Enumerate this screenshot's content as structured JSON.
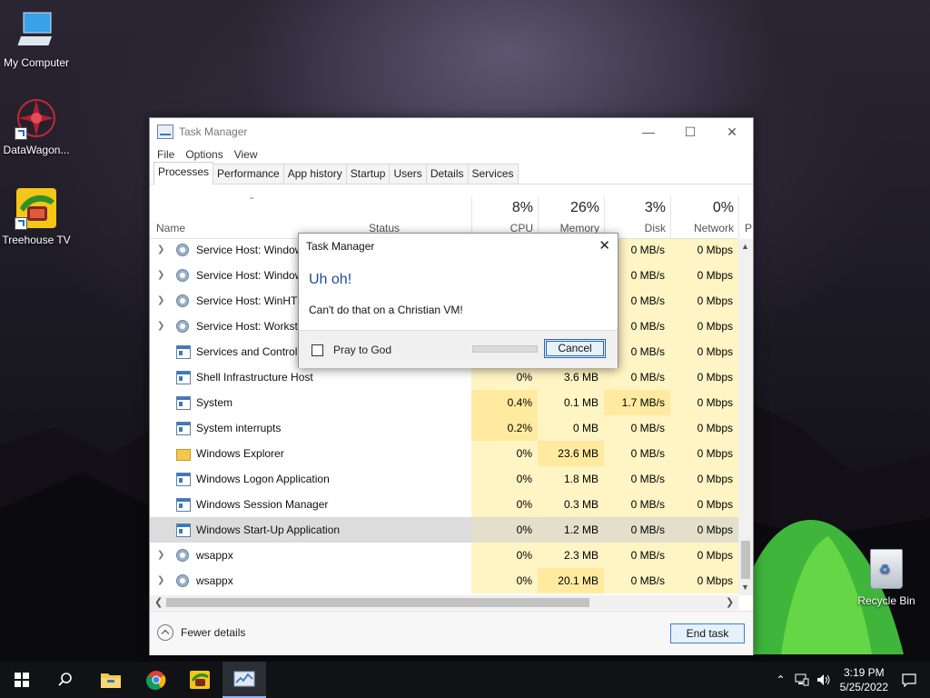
{
  "desktop": {
    "icons": [
      {
        "label": "My Computer",
        "icon": "computer-icon"
      },
      {
        "label": "DataWagon...",
        "icon": "datawagon-icon"
      },
      {
        "label": "Treehouse TV",
        "icon": "treehouse-tv-icon"
      }
    ],
    "recycle_bin": "Recycle Bin"
  },
  "task_manager": {
    "title": "Task Manager",
    "menu": [
      "File",
      "Options",
      "View"
    ],
    "tabs": [
      "Processes",
      "Performance",
      "App history",
      "Startup",
      "Users",
      "Details",
      "Services"
    ],
    "active_tab": "Processes",
    "columns": {
      "name": "Name",
      "status": "Status",
      "cpu": {
        "label": "CPU",
        "percent": "8%"
      },
      "memory": {
        "label": "Memory",
        "percent": "26%"
      },
      "disk": {
        "label": "Disk",
        "percent": "3%"
      },
      "network": {
        "label": "Network",
        "percent": "0%"
      },
      "power": "P"
    },
    "rows": [
      {
        "name": "Service Host: Window",
        "icon": "gear",
        "expand": true,
        "cpu": "",
        "memory": "",
        "disk": "0 MB/s",
        "network": "0 Mbps"
      },
      {
        "name": "Service Host: Window",
        "icon": "gear",
        "expand": true,
        "cpu": "",
        "memory": "",
        "disk": "0 MB/s",
        "network": "0 Mbps"
      },
      {
        "name": "Service Host: WinHTT",
        "icon": "gear",
        "expand": true,
        "cpu": "",
        "memory": "",
        "disk": "0 MB/s",
        "network": "0 Mbps"
      },
      {
        "name": "Service Host: Worksta",
        "icon": "gear",
        "expand": true,
        "cpu": "",
        "memory": "",
        "disk": "0 MB/s",
        "network": "0 Mbps"
      },
      {
        "name": "Services and Controlle",
        "icon": "win",
        "expand": false,
        "cpu": "",
        "memory": "",
        "disk": "0 MB/s",
        "network": "0 Mbps"
      },
      {
        "name": "Shell Infrastructure Host",
        "icon": "win",
        "expand": false,
        "cpu": "0%",
        "memory": "3.6 MB",
        "disk": "0 MB/s",
        "network": "0 Mbps"
      },
      {
        "name": "System",
        "icon": "win",
        "expand": false,
        "cpu": "0.4%",
        "memory": "0.1 MB",
        "disk": "1.7 MB/s",
        "network": "0 Mbps"
      },
      {
        "name": "System interrupts",
        "icon": "win",
        "expand": false,
        "cpu": "0.2%",
        "memory": "0 MB",
        "disk": "0 MB/s",
        "network": "0 Mbps"
      },
      {
        "name": "Windows Explorer",
        "icon": "folder",
        "expand": false,
        "cpu": "0%",
        "memory": "23.6 MB",
        "disk": "0 MB/s",
        "network": "0 Mbps"
      },
      {
        "name": "Windows Logon Application",
        "icon": "win",
        "expand": false,
        "cpu": "0%",
        "memory": "1.8 MB",
        "disk": "0 MB/s",
        "network": "0 Mbps"
      },
      {
        "name": "Windows Session Manager",
        "icon": "win",
        "expand": false,
        "cpu": "0%",
        "memory": "0.3 MB",
        "disk": "0 MB/s",
        "network": "0 Mbps"
      },
      {
        "name": "Windows Start-Up Application",
        "icon": "win",
        "expand": false,
        "selected": true,
        "cpu": "0%",
        "memory": "1.2 MB",
        "disk": "0 MB/s",
        "network": "0 Mbps"
      },
      {
        "name": "wsappx",
        "icon": "gear",
        "expand": true,
        "cpu": "0%",
        "memory": "2.3 MB",
        "disk": "0 MB/s",
        "network": "0 Mbps"
      },
      {
        "name": "wsappx",
        "icon": "gear",
        "expand": true,
        "cpu": "0%",
        "memory": "20.1 MB",
        "disk": "0 MB/s",
        "network": "0 Mbps"
      }
    ],
    "footer": {
      "fewer_details": "Fewer details",
      "end_task": "End task"
    }
  },
  "dialog": {
    "title": "Task Manager",
    "heading": "Uh oh!",
    "message": "Can't do that on a Christian VM!",
    "checkbox_label": "Pray to God",
    "cancel": "Cancel"
  },
  "taskbar": {
    "items": [
      "start-icon",
      "search-icon",
      "file-explorer-icon",
      "chrome-icon",
      "treehouse-tv-icon",
      "task-manager-icon"
    ],
    "time": "3:19 PM",
    "date": "5/25/2022"
  }
}
